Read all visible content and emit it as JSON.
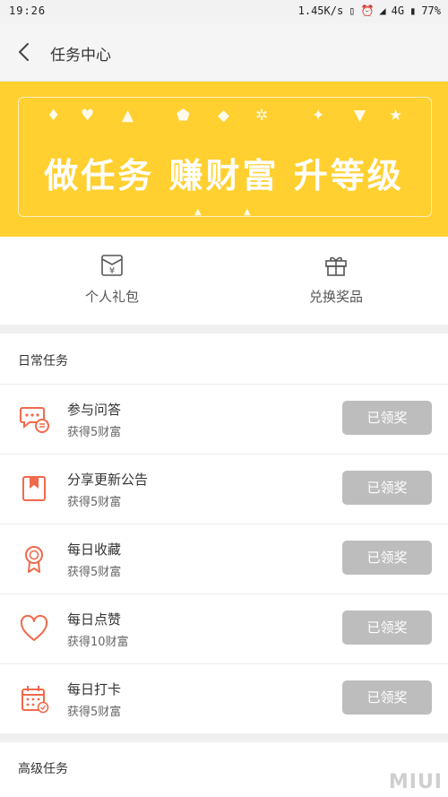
{
  "status_bar": {
    "time": "19:26",
    "speed": "1.45K/s",
    "network": "4G",
    "battery": "77%"
  },
  "header": {
    "title": "任务中心"
  },
  "banner": {
    "text": "做任务 赚财富 升等级"
  },
  "quick_actions": [
    {
      "label": "个人礼包",
      "icon": "gift-pack-icon"
    },
    {
      "label": "兑换奖品",
      "icon": "gift-box-icon"
    }
  ],
  "daily": {
    "title": "日常任务",
    "tasks": [
      {
        "name": "参与问答",
        "reward": "获得5财富",
        "button": "已领奖",
        "icon": "chat-icon"
      },
      {
        "name": "分享更新公告",
        "reward": "获得5财富",
        "button": "已领奖",
        "icon": "bookmark-icon"
      },
      {
        "name": "每日收藏",
        "reward": "获得5财富",
        "button": "已领奖",
        "icon": "medal-icon"
      },
      {
        "name": "每日点赞",
        "reward": "获得10财富",
        "button": "已领奖",
        "icon": "heart-icon"
      },
      {
        "name": "每日打卡",
        "reward": "获得5财富",
        "button": "已领奖",
        "icon": "calendar-icon"
      }
    ]
  },
  "advanced": {
    "title": "高级任务"
  },
  "watermark": "MIUI",
  "colors": {
    "banner": "#ffd02f",
    "accent": "#f06a4c",
    "button_disabled": "#bdbdbd"
  }
}
